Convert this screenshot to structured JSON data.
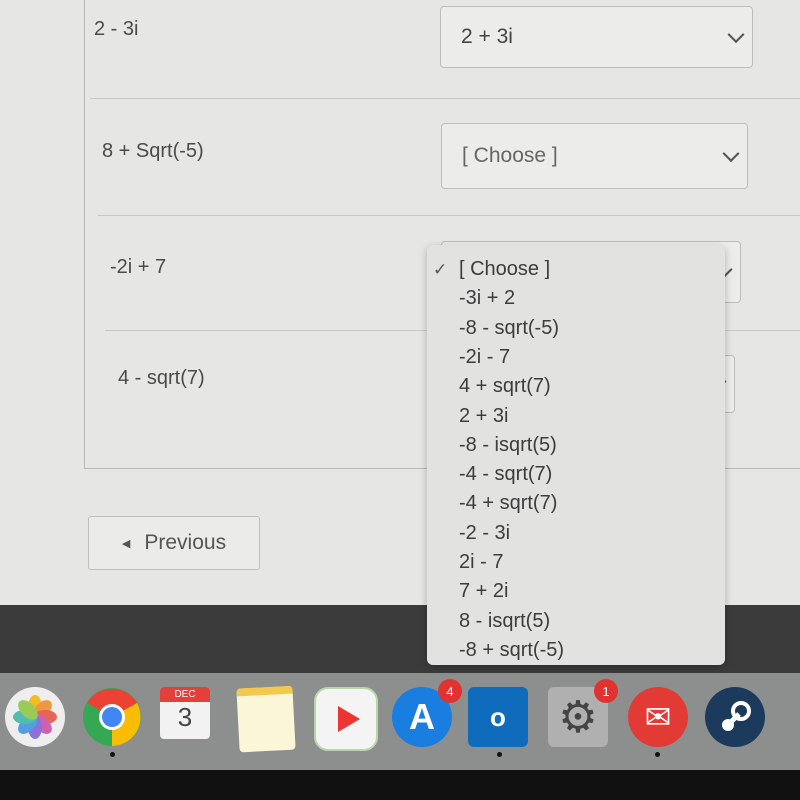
{
  "questions": [
    {
      "prompt": "2 - 3i",
      "selected": "2 + 3i"
    },
    {
      "prompt": "8 + Sqrt(-5)",
      "selected": "[ Choose ]"
    },
    {
      "prompt": "-2i + 7",
      "selected": "[ Choose ]"
    },
    {
      "prompt": "4 - sqrt(7)",
      "selected": ""
    }
  ],
  "dropdown": {
    "checkmark": "✓",
    "options": [
      "[ Choose ]",
      "-3i + 2",
      "-8 - sqrt(-5)",
      "-2i - 7",
      "4 + sqrt(7)",
      "2 + 3i",
      "-8 - isqrt(5)",
      "-4 - sqrt(7)",
      "-4 + sqrt(7)",
      "-2 - 3i",
      "2i - 7",
      "7 + 2i",
      "8 - isqrt(5)",
      "-8 + sqrt(-5)"
    ]
  },
  "nav": {
    "previous_label": "Previous"
  },
  "dock": {
    "apps": [
      "photos",
      "chrome",
      "calendar",
      "notes",
      "video-player",
      "app-store",
      "outlook",
      "system-preferences",
      "mail",
      "steam"
    ],
    "calendar_month": "DEC",
    "calendar_day": "3",
    "app_store_badge": "4",
    "system_prefs_badge": "1"
  }
}
